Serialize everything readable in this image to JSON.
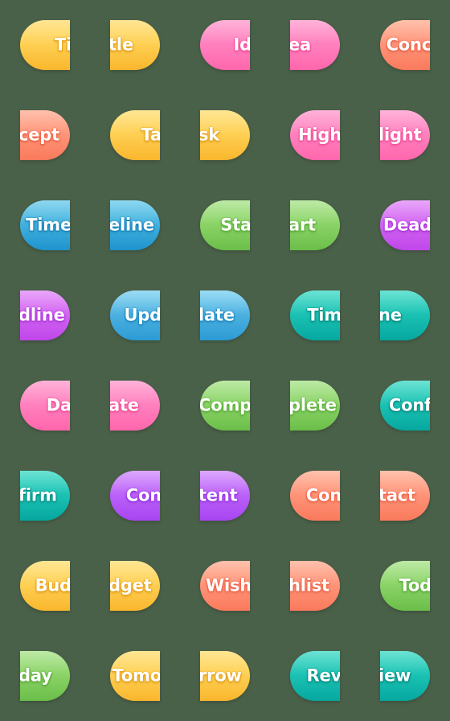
{
  "sheet": {
    "background_color": "#4a6149",
    "columns": 5,
    "rows": 8,
    "cell_size_px": 112,
    "badge_size_px": 62,
    "description": "Sticker sheet of rounded word pill badges; each word is split across two adjacent half-pills"
  },
  "palette": {
    "yellow": "#FFD257",
    "pink": "#FF82BF",
    "salmon": "#FF957A",
    "blue": "#44B2DF",
    "green": "#8CD468",
    "magenta": "#D266F2",
    "skyblue": "#4FB2E1",
    "teal": "#1CC3B4",
    "violet": "#BC63F8",
    "text": "#FFFFFF"
  },
  "words": [
    "Title",
    "Idea",
    "Concept",
    "Task",
    "Highlight",
    "Timeline",
    "Start",
    "Deadline",
    "Update",
    "Time",
    "Date",
    "Complete",
    "Confirm",
    "Content",
    "Contact",
    "Budget",
    "Wishlist",
    "Today",
    "Tomorrow",
    "Review"
  ],
  "badges": [
    {
      "text": "Ti",
      "half": "left",
      "theme": "t-yellow",
      "word": "Title"
    },
    {
      "text": "tle",
      "half": "right",
      "theme": "t-yellow",
      "word": "Title"
    },
    {
      "text": "Id",
      "half": "left",
      "theme": "t-pink",
      "word": "Idea"
    },
    {
      "text": "ea",
      "half": "right",
      "theme": "t-pink",
      "word": "Idea"
    },
    {
      "text": "Conc",
      "half": "left",
      "theme": "t-salmon",
      "word": "Concept"
    },
    {
      "text": "cept",
      "half": "right",
      "theme": "t-salmon",
      "word": "Concept"
    },
    {
      "text": "Ta",
      "half": "left",
      "theme": "t-yellow",
      "word": "Task"
    },
    {
      "text": "sk",
      "half": "right",
      "theme": "t-yellow",
      "word": "Task"
    },
    {
      "text": "High",
      "half": "left",
      "theme": "t-pink",
      "word": "Highlight"
    },
    {
      "text": "light",
      "half": "right",
      "theme": "t-pink",
      "word": "Highlight"
    },
    {
      "text": "Time",
      "half": "left",
      "theme": "t-blue",
      "word": "Timeline"
    },
    {
      "text": "eline",
      "half": "right",
      "theme": "t-blue",
      "word": "Timeline"
    },
    {
      "text": "Sta",
      "half": "left",
      "theme": "t-green",
      "word": "Start"
    },
    {
      "text": "art",
      "half": "right",
      "theme": "t-green",
      "word": "Start"
    },
    {
      "text": "Dead",
      "half": "left",
      "theme": "t-magenta",
      "word": "Deadline"
    },
    {
      "text": "dline",
      "half": "right",
      "theme": "t-magenta",
      "word": "Deadline"
    },
    {
      "text": "Upd",
      "half": "left",
      "theme": "t-skyblue",
      "word": "Update"
    },
    {
      "text": "late",
      "half": "right",
      "theme": "t-skyblue",
      "word": "Update"
    },
    {
      "text": "Tim",
      "half": "left",
      "theme": "t-teal",
      "word": "Time"
    },
    {
      "text": "ne",
      "half": "right",
      "theme": "t-teal",
      "word": "Time"
    },
    {
      "text": "Da",
      "half": "left",
      "theme": "t-pink",
      "word": "Date"
    },
    {
      "text": "ate",
      "half": "right",
      "theme": "t-pink",
      "word": "Date"
    },
    {
      "text": "Comp",
      "half": "left",
      "theme": "t-green",
      "word": "Complete"
    },
    {
      "text": "plete",
      "half": "right",
      "theme": "t-green",
      "word": "Complete"
    },
    {
      "text": "Conf",
      "half": "left",
      "theme": "t-teal",
      "word": "Confirm"
    },
    {
      "text": "firm",
      "half": "right",
      "theme": "t-teal",
      "word": "Confirm"
    },
    {
      "text": "Con",
      "half": "left",
      "theme": "t-violet",
      "word": "Content"
    },
    {
      "text": "tent",
      "half": "right",
      "theme": "t-violet",
      "word": "Content"
    },
    {
      "text": "Con",
      "half": "left",
      "theme": "t-salmon",
      "word": "Contact"
    },
    {
      "text": "tact",
      "half": "right",
      "theme": "t-salmon",
      "word": "Contact"
    },
    {
      "text": "Bud",
      "half": "left",
      "theme": "t-yellow",
      "word": "Budget"
    },
    {
      "text": "dget",
      "half": "right",
      "theme": "t-yellow",
      "word": "Budget"
    },
    {
      "text": "Wish",
      "half": "left",
      "theme": "t-salmon",
      "word": "Wishlist"
    },
    {
      "text": "hlist",
      "half": "right",
      "theme": "t-salmon",
      "word": "Wishlist"
    },
    {
      "text": "Tod",
      "half": "left",
      "theme": "t-green",
      "word": "Today"
    },
    {
      "text": "day",
      "half": "right",
      "theme": "t-green",
      "word": "Today"
    },
    {
      "text": "Tomo",
      "half": "left",
      "theme": "t-yellow",
      "word": "Tomorrow"
    },
    {
      "text": "rrow",
      "half": "right",
      "theme": "t-yellow",
      "word": "Tomorrow"
    },
    {
      "text": "Rev",
      "half": "left",
      "theme": "t-teal",
      "word": "Review"
    },
    {
      "text": "iew",
      "half": "right",
      "theme": "t-teal",
      "word": "Review"
    }
  ]
}
